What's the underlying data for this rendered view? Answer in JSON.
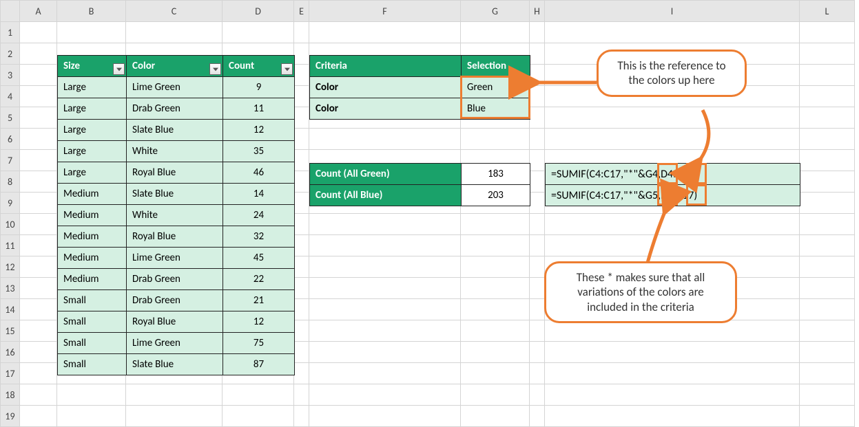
{
  "columns": [
    "A",
    "B",
    "C",
    "D",
    "E",
    "F",
    "G",
    "H",
    "I",
    "L"
  ],
  "rows": [
    "1",
    "2",
    "3",
    "4",
    "5",
    "6",
    "7",
    "8",
    "9",
    "10",
    "11",
    "12",
    "13",
    "14",
    "15",
    "16",
    "17",
    "18",
    "19"
  ],
  "table1": {
    "headers": [
      "Size",
      "Color",
      "Count"
    ],
    "rows": [
      [
        "Large",
        "Lime Green",
        "9"
      ],
      [
        "Large",
        "Drab Green",
        "11"
      ],
      [
        "Large",
        "Slate Blue",
        "12"
      ],
      [
        "Large",
        "White",
        "35"
      ],
      [
        "Large",
        "Royal Blue",
        "46"
      ],
      [
        "Medium",
        "Slate Blue",
        "14"
      ],
      [
        "Medium",
        "White",
        "24"
      ],
      [
        "Medium",
        "Royal Blue",
        "32"
      ],
      [
        "Medium",
        "Lime Green",
        "45"
      ],
      [
        "Medium",
        "Drab Green",
        "22"
      ],
      [
        "Small",
        "Drab Green",
        "21"
      ],
      [
        "Small",
        "Royal Blue",
        "12"
      ],
      [
        "Small",
        "Lime Green",
        "75"
      ],
      [
        "Small",
        "Slate Blue",
        "87"
      ]
    ]
  },
  "criteria": {
    "headers": [
      "Criteria",
      "Selection"
    ],
    "rows": [
      [
        "Color",
        "Green"
      ],
      [
        "Color",
        "Blue"
      ]
    ]
  },
  "totals": {
    "rows": [
      {
        "label": "Count (All Green)",
        "value": "183",
        "formula": "=SUMIF(C4:C17,\"*\"&G4,D4:D17)"
      },
      {
        "label": "Count (All Blue)",
        "value": "203",
        "formula": "=SUMIF(C4:C17,\"*\"&G5,D4:D17)"
      }
    ]
  },
  "callout1": "This is the reference to the colors up here",
  "callout2": "These * makes sure that all variations of the colors are included in the criteria"
}
